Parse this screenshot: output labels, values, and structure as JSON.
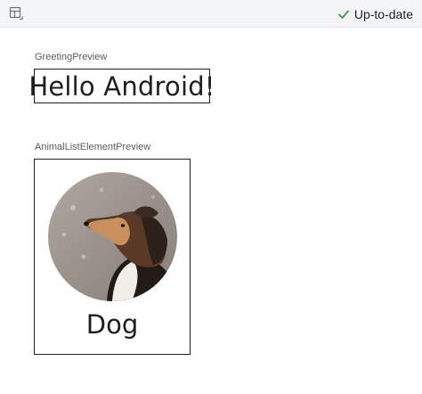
{
  "toolbar": {
    "layout_icon": "layout-grid-icon",
    "status_icon": "checkmark-icon",
    "status_label": "Up-to-date",
    "status_color": "#3c9a48"
  },
  "previews": [
    {
      "label": "GreetingPreview",
      "content": "Hello Android!"
    },
    {
      "label": "AnimalListElementPreview",
      "content": "Dog",
      "image": "dog-photo"
    }
  ]
}
